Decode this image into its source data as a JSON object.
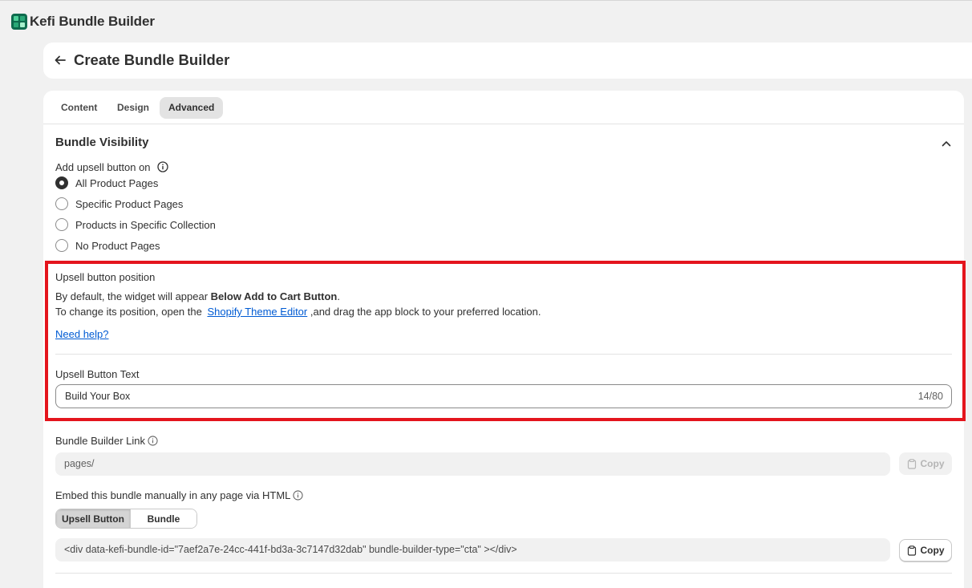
{
  "app": {
    "title": "Kefi Bundle Builder",
    "logo_icon": "kefi-logo-icon"
  },
  "header": {
    "title": "Create Bundle Builder",
    "back_icon": "arrow-left-icon"
  },
  "tabs": [
    {
      "label": "Content",
      "active": false
    },
    {
      "label": "Design",
      "active": false
    },
    {
      "label": "Advanced",
      "active": true
    }
  ],
  "visibility": {
    "title": "Bundle Visibility",
    "add_upsell_label": "Add upsell button on",
    "options": [
      {
        "label": "All Product Pages",
        "checked": true
      },
      {
        "label": "Specific Product Pages",
        "checked": false
      },
      {
        "label": "Products in Specific Collection",
        "checked": false
      },
      {
        "label": "No Product Pages",
        "checked": false
      }
    ]
  },
  "position": {
    "title": "Upsell button position",
    "line1_prefix": "By default, the widget will appear ",
    "line1_bold": "Below Add to Cart Button",
    "line1_suffix": ".",
    "line2_prefix": "To change its position, open the ",
    "line2_link": "Shopify Theme Editor",
    "line2_suffix": " ,and drag the app block to your preferred location.",
    "help_link": "Need help?"
  },
  "upsell_text": {
    "label": "Upsell Button Text",
    "value": "Build Your Box",
    "counter": "14/80"
  },
  "builder_link": {
    "label": "Bundle Builder Link",
    "value": "pages/",
    "copy_label": "Copy"
  },
  "embed": {
    "label": "Embed this bundle manually in any page via HTML",
    "segments": [
      "Upsell Button",
      "Bundle"
    ],
    "code": "<div data-kefi-bundle-id=\"7aef2a7e-24cc-441f-bd3a-3c7147d32dab\" bundle-builder-type=\"cta\" ></div>",
    "copy_label": "Copy"
  },
  "colors": {
    "highlight": "#e4151d",
    "link": "#005bd3"
  }
}
